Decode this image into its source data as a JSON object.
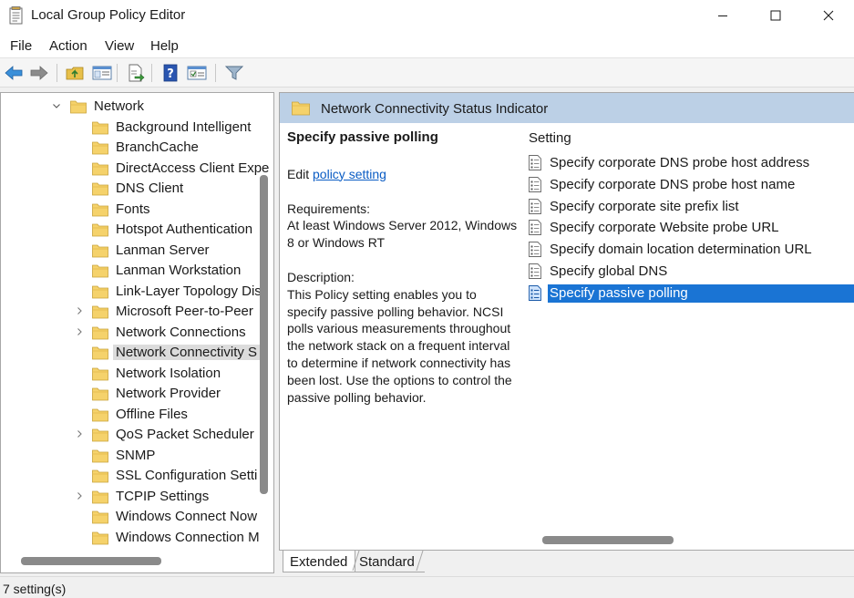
{
  "window": {
    "title": "Local Group Policy Editor"
  },
  "menu": {
    "items": [
      "File",
      "Action",
      "View",
      "Help"
    ]
  },
  "toolbar": {
    "buttons": [
      "back-arrow-icon",
      "forward-arrow-icon",
      "up-folder-icon",
      "show-hide-tree-icon",
      "export-list-icon",
      "help-icon",
      "properties-icon",
      "filter-icon"
    ]
  },
  "tree": {
    "items": [
      {
        "label": "Network",
        "expander": "expanded"
      },
      {
        "label": "Background Intelligent",
        "expander": ""
      },
      {
        "label": "BranchCache",
        "expander": ""
      },
      {
        "label": "DirectAccess Client Expe",
        "expander": ""
      },
      {
        "label": "DNS Client",
        "expander": ""
      },
      {
        "label": "Fonts",
        "expander": ""
      },
      {
        "label": "Hotspot Authentication",
        "expander": ""
      },
      {
        "label": "Lanman Server",
        "expander": ""
      },
      {
        "label": "Lanman Workstation",
        "expander": ""
      },
      {
        "label": "Link-Layer Topology Dis",
        "expander": ""
      },
      {
        "label": "Microsoft Peer-to-Peer",
        "expander": "collapsed"
      },
      {
        "label": "Network Connections",
        "expander": "collapsed"
      },
      {
        "label": "Network Connectivity S",
        "expander": "",
        "selected": true
      },
      {
        "label": "Network Isolation",
        "expander": ""
      },
      {
        "label": "Network Provider",
        "expander": ""
      },
      {
        "label": "Offline Files",
        "expander": ""
      },
      {
        "label": "QoS Packet Scheduler",
        "expander": "collapsed"
      },
      {
        "label": "SNMP",
        "expander": ""
      },
      {
        "label": "SSL Configuration Setti",
        "expander": ""
      },
      {
        "label": "TCPIP Settings",
        "expander": "collapsed"
      },
      {
        "label": "Windows Connect Now",
        "expander": ""
      },
      {
        "label": "Windows Connection M",
        "expander": ""
      }
    ]
  },
  "right_pane": {
    "header": "Network Connectivity Status Indicator",
    "description": {
      "title": "Specify passive polling",
      "edit_prefix": "Edit ",
      "edit_link": "policy setting ",
      "requirements_label": "Requirements:",
      "requirements_text": "At least Windows Server 2012, Windows 8 or Windows RT",
      "description_label": "Description:",
      "description_text": "This Policy setting enables you to specify passive polling behavior. NCSI polls various measurements throughout the network stack on a frequent interval to determine if network connectivity has been lost. Use the options to control the passive polling behavior."
    },
    "settings_header": "Setting",
    "settings": [
      {
        "label": "Specify corporate DNS probe host address"
      },
      {
        "label": "Specify corporate DNS probe host name"
      },
      {
        "label": "Specify corporate site prefix list"
      },
      {
        "label": "Specify corporate Website probe URL"
      },
      {
        "label": "Specify domain location determination URL"
      },
      {
        "label": "Specify global DNS"
      },
      {
        "label": "Specify passive polling",
        "selected": true
      }
    ]
  },
  "tabs": {
    "extended": "Extended",
    "standard": "Standard",
    "active": "Extended"
  },
  "status": {
    "text": "7 setting(s)"
  },
  "colors": {
    "selection": "#1a74d4",
    "header_band": "#bcd0e6",
    "link": "#0a5cc4",
    "folder": "#f5d26b"
  }
}
